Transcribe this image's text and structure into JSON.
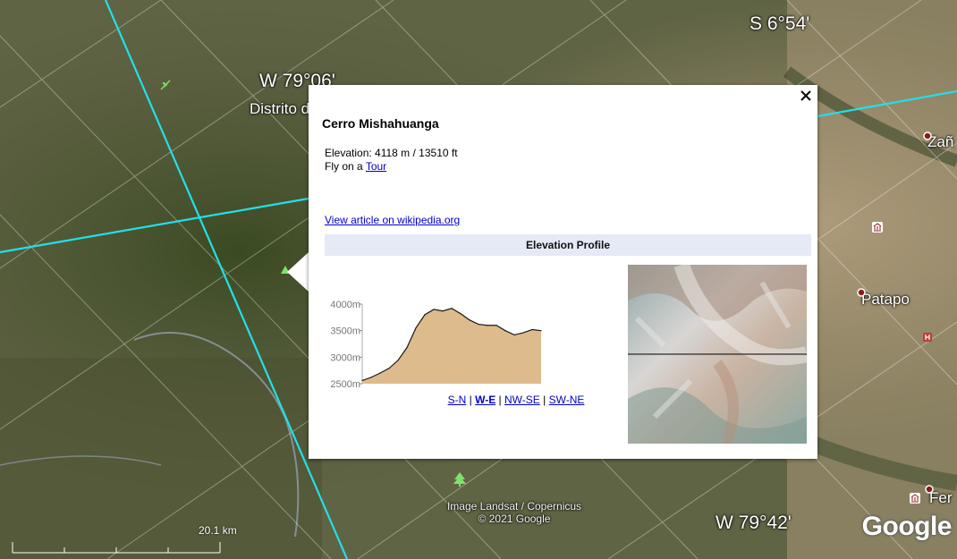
{
  "map": {
    "coord_labels": [
      "S 6°54'",
      "W 79°06'",
      "W 79°42'"
    ],
    "place_labels": [
      "Distrito d",
      "Zañ",
      "Patapo",
      "Fer"
    ],
    "attribution_line1": "Image Landsat / Copernicus",
    "attribution_line2": "© 2021 Google",
    "scale_label": "20.1 km",
    "logo_text": "Google",
    "colors": {
      "graticule_major": "#22e0e8",
      "graticule_minor": "#ffffff",
      "pin_red": "#8b1a1a",
      "tree_pin": "#7ee36a"
    }
  },
  "balloon": {
    "title": "Cerro Mishahuanga",
    "elevation_text": "Elevation: 4118 m / 13510 ft",
    "fly_prefix": "Fly on a ",
    "fly_link": "Tour",
    "wiki_link": "View article on wikipedia.org",
    "profile_header": "Elevation Profile",
    "directions": [
      {
        "label": "S-N",
        "active": false
      },
      {
        "label": "W-E",
        "active": true
      },
      {
        "label": "NW-SE",
        "active": false
      },
      {
        "label": "SW-NE",
        "active": false
      }
    ],
    "separator": " | ",
    "close_icon": "close-icon"
  },
  "chart_data": {
    "type": "area",
    "title": "",
    "xlabel": "",
    "ylabel": "",
    "ylim": [
      2500,
      4000
    ],
    "yticks": [
      4000,
      3500,
      3000,
      2500
    ],
    "ytick_labels": [
      "4000m",
      "3500m",
      "3000m",
      "2500m"
    ],
    "x": [
      0,
      5,
      10,
      15,
      20,
      25,
      30,
      35,
      40,
      45,
      50,
      55,
      60,
      65,
      70,
      75,
      80,
      85,
      90,
      95,
      100
    ],
    "values": [
      2560,
      2620,
      2700,
      2790,
      2940,
      3180,
      3550,
      3800,
      3900,
      3870,
      3920,
      3820,
      3700,
      3620,
      3600,
      3600,
      3500,
      3420,
      3460,
      3520,
      3500
    ],
    "fill_color": "#debb8c",
    "line_color": "#1a1a1a",
    "grid": false
  }
}
